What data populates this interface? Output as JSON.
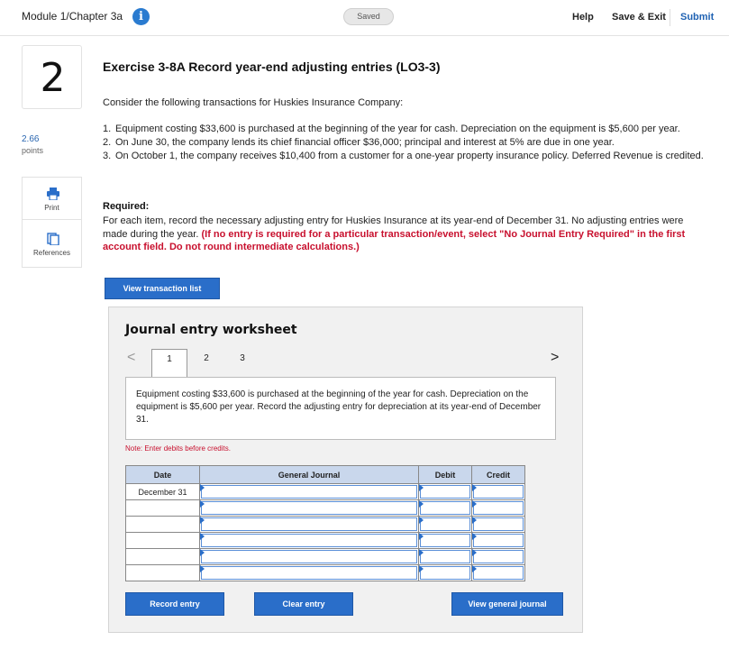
{
  "topbar": {
    "module_title": "Module 1/Chapter 3a",
    "info_glyph": "i",
    "saved_label": "Saved",
    "help_label": "Help",
    "save_exit_label": "Save & Exit",
    "submit_label": "Submit"
  },
  "rail": {
    "question_number": "2",
    "points_value": "2.66",
    "points_label": "points",
    "print_label": "Print",
    "references_label": "References",
    "print_icon": "printer-icon",
    "references_icon": "book-icon"
  },
  "exercise": {
    "title": "Exercise 3-8A Record year-end adjusting entries (LO3-3)",
    "intro": "Consider the following transactions for Huskies Insurance Company:",
    "transactions": [
      {
        "num": "1.",
        "text": "Equipment costing $33,600 is purchased at the beginning of the year for cash. Depreciation on the equipment is $5,600 per year."
      },
      {
        "num": "2.",
        "text": "On June 30, the company lends its chief financial officer $36,000; principal and interest at 5% are due in one year."
      },
      {
        "num": "3.",
        "text": "On October 1, the company receives $10,400 from a customer for a one-year property insurance policy. Deferred Revenue is credited."
      }
    ],
    "required_title": "Required:",
    "required_text": "For each item, record the necessary adjusting entry for Huskies Insurance at its year-end of December 31. No adjusting entries were made during the year.",
    "required_note": "(If no entry is required for a particular transaction/event, select \"No Journal Entry Required\" in the first account field. Do not round intermediate calculations.)"
  },
  "buttons": {
    "view_transaction_list": "View transaction list",
    "record_entry": "Record entry",
    "clear_entry": "Clear entry",
    "view_general_journal": "View general journal"
  },
  "worksheet": {
    "title": "Journal entry worksheet",
    "prev_glyph": "<",
    "next_glyph": ">",
    "tabs": [
      "1",
      "2",
      "3"
    ],
    "description": "Equipment costing $33,600 is purchased at the beginning of the year for cash. Depreciation on the equipment is $5,600 per year. Record the adjusting entry for depreciation at its year-end of December 31.",
    "note": "Note: Enter debits before credits.",
    "columns": [
      "Date",
      "General Journal",
      "Debit",
      "Credit"
    ],
    "rows": [
      {
        "date": "December 31"
      },
      {
        "date": ""
      },
      {
        "date": ""
      },
      {
        "date": ""
      },
      {
        "date": ""
      },
      {
        "date": ""
      }
    ]
  },
  "colors": {
    "accent": "#2a6ec9",
    "warning_red": "#c8102e",
    "header_blue": "#c9d7ec"
  }
}
